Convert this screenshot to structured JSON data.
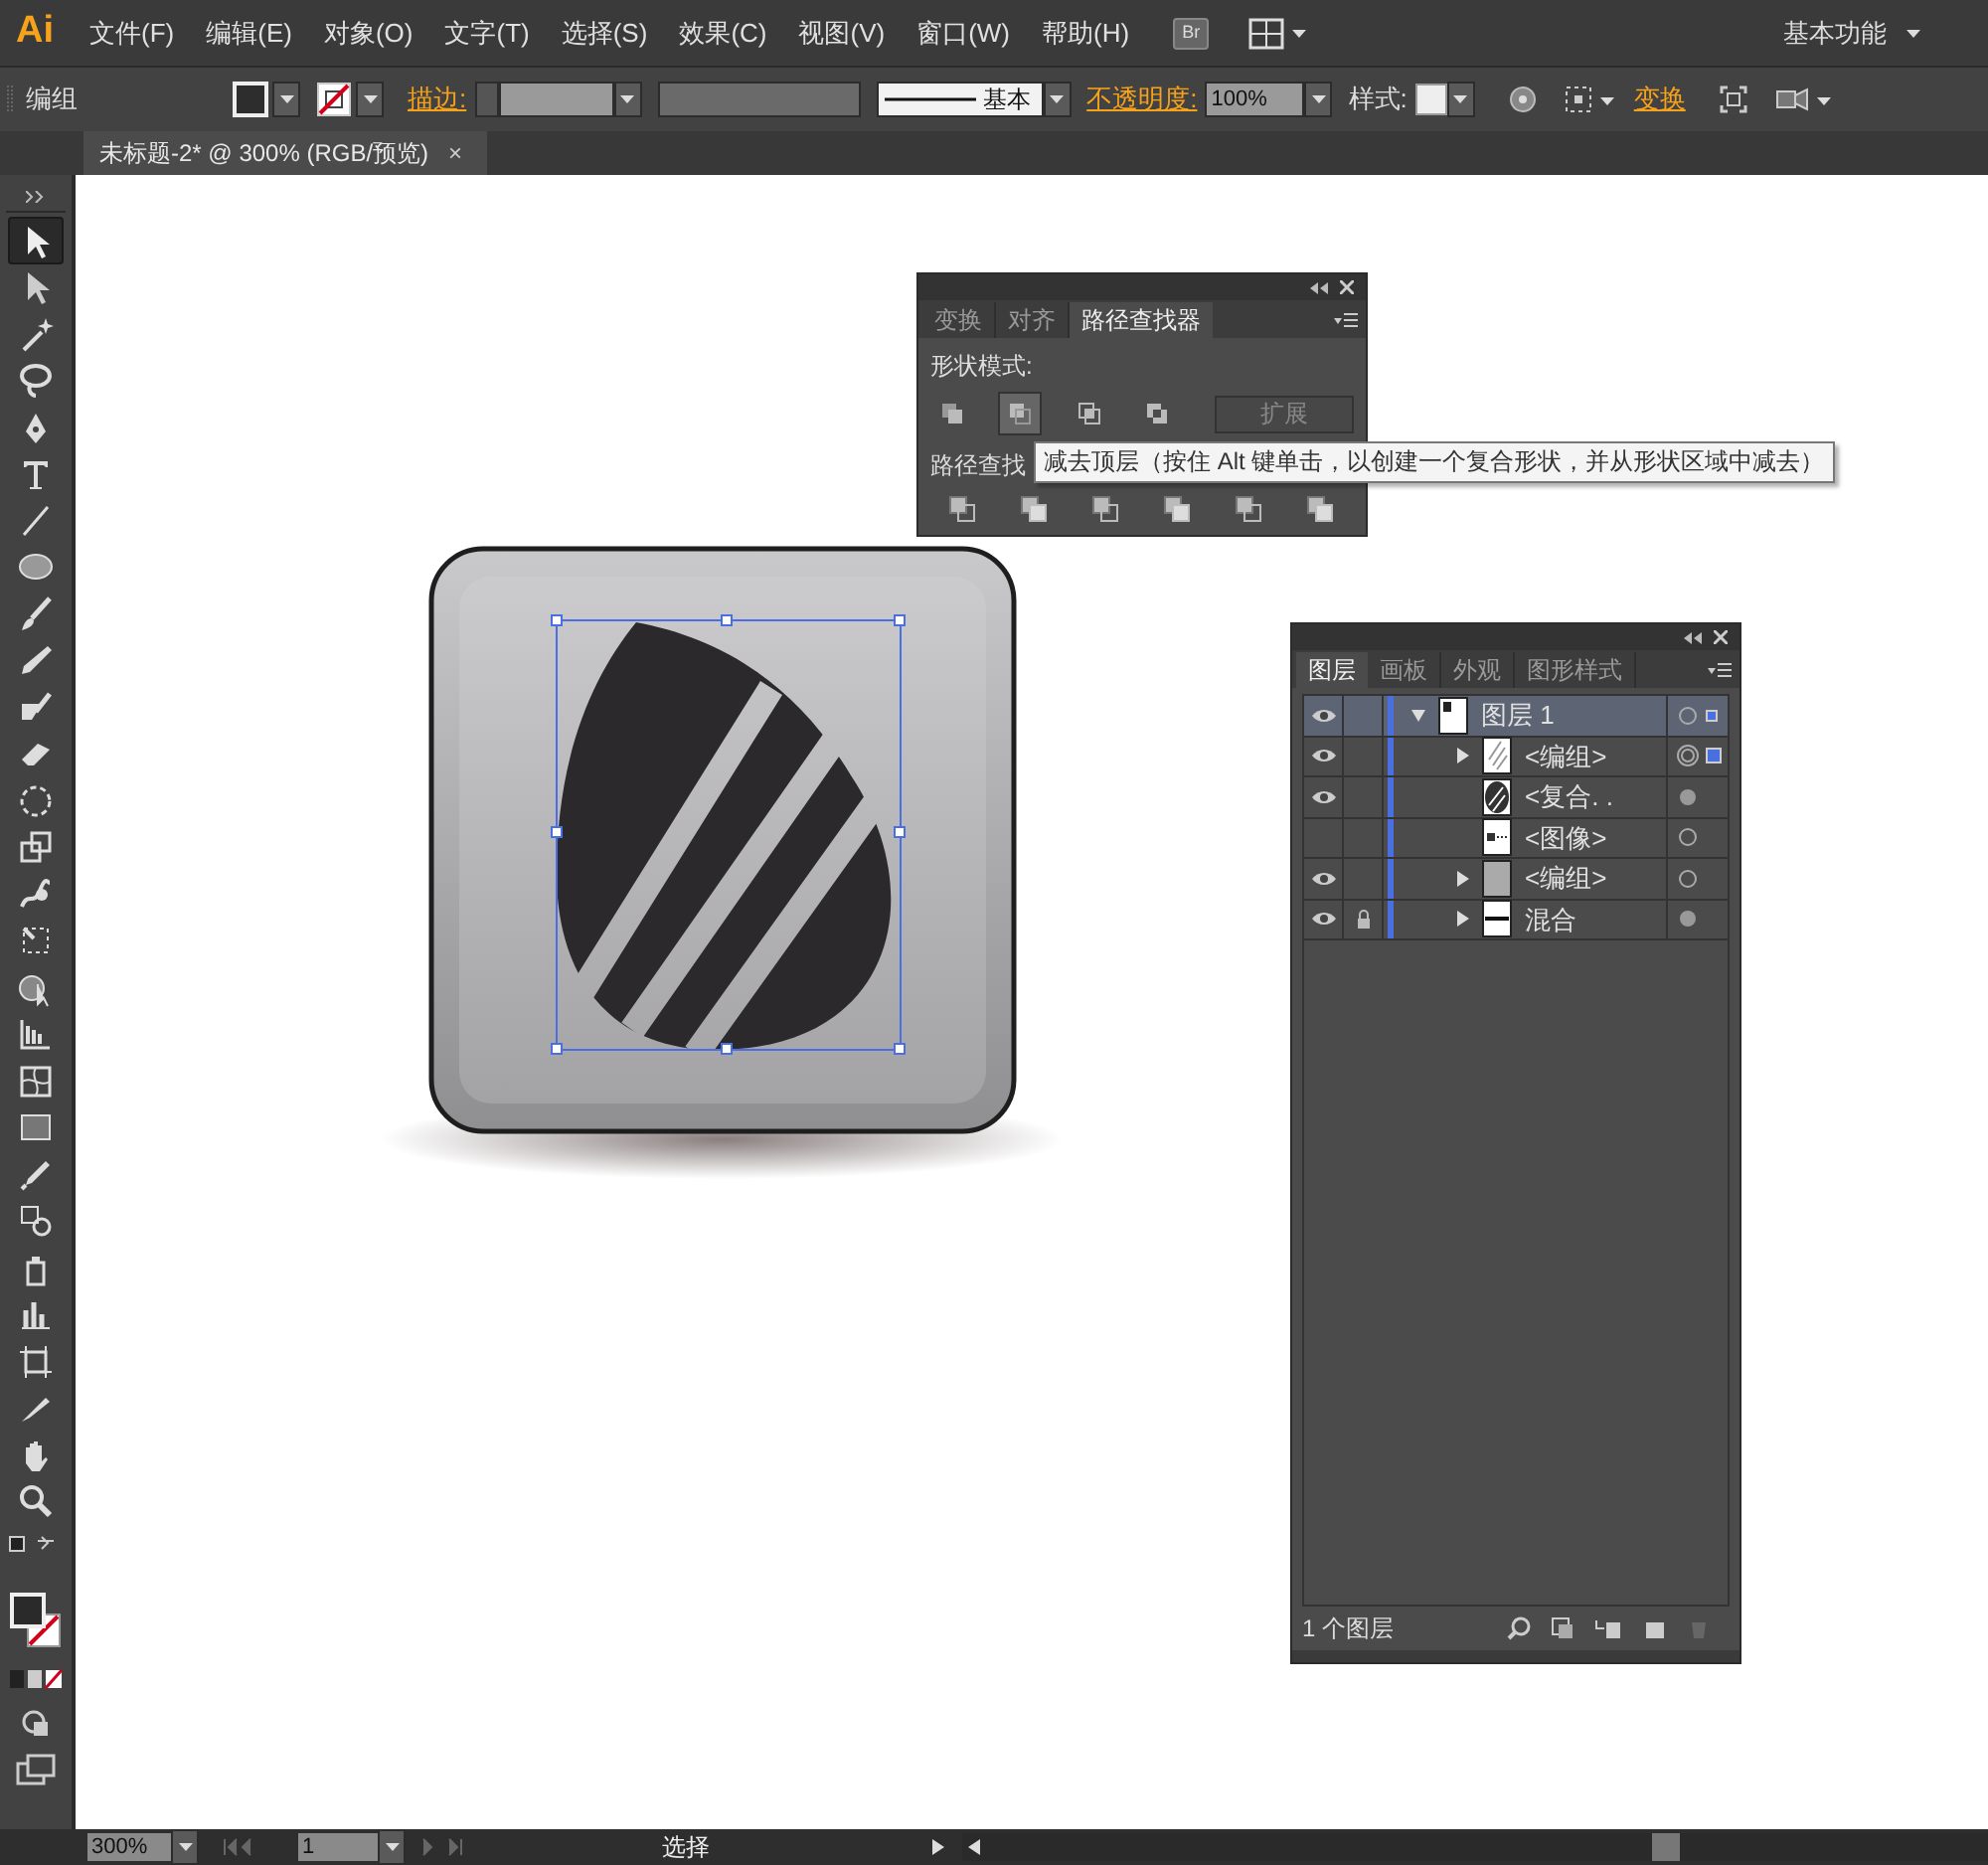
{
  "app": {
    "logo": "Ai",
    "menus": [
      "文件(F)",
      "编辑(E)",
      "对象(O)",
      "文字(T)",
      "选择(S)",
      "效果(C)",
      "视图(V)",
      "窗口(W)",
      "帮助(H)"
    ],
    "bridge": "Br",
    "workspace": "基本功能"
  },
  "control_bar": {
    "selection": "编组",
    "stroke_label": "描边:",
    "stroke_style": "基本",
    "opacity_label": "不透明度:",
    "opacity": "100%",
    "style_label": "样式:",
    "transform_link": "变换"
  },
  "document_tab": {
    "title": "未标题-2* @ 300% (RGB/预览)",
    "close": "×"
  },
  "tools": [
    {
      "kind": "select",
      "selected": true
    },
    {
      "kind": "direct",
      "selected": false
    },
    {
      "kind": "wand",
      "selected": false
    },
    {
      "kind": "lasso",
      "selected": false
    },
    {
      "kind": "pen",
      "selected": false
    },
    {
      "kind": "type",
      "selected": false
    },
    {
      "kind": "line",
      "selected": false
    },
    {
      "kind": "ellipse",
      "selected": false
    },
    {
      "kind": "brush",
      "selected": false
    },
    {
      "kind": "pencil",
      "selected": false
    },
    {
      "kind": "blob",
      "selected": false
    },
    {
      "kind": "eraser",
      "selected": false
    },
    {
      "kind": "rotate",
      "selected": false
    },
    {
      "kind": "scale",
      "selected": false
    },
    {
      "kind": "warp",
      "selected": false
    },
    {
      "kind": "transform",
      "selected": false
    },
    {
      "kind": "builder",
      "selected": false
    },
    {
      "kind": "grid",
      "selected": false
    },
    {
      "kind": "mesh",
      "selected": false
    },
    {
      "kind": "gradient",
      "selected": false
    },
    {
      "kind": "eyedropper",
      "selected": false
    },
    {
      "kind": "blend",
      "selected": false
    },
    {
      "kind": "spray",
      "selected": false
    },
    {
      "kind": "graph",
      "selected": false
    },
    {
      "kind": "artboard",
      "selected": false
    },
    {
      "kind": "slice",
      "selected": false
    },
    {
      "kind": "hand",
      "selected": false
    },
    {
      "kind": "zoom",
      "selected": false
    }
  ],
  "pathfinder_panel": {
    "tabs": [
      {
        "label": "变换",
        "selected": false
      },
      {
        "label": "对齐",
        "selected": false
      },
      {
        "label": "路径查找器",
        "selected": true
      }
    ],
    "shape_modes_label": "形状模式:",
    "shape_modes": [
      {
        "selected": false
      },
      {
        "selected": true
      },
      {
        "selected": false
      },
      {
        "selected": false
      }
    ],
    "expand_button": "扩展",
    "pathfinders_label": "路径查找"
  },
  "tooltip": "减去顶层（按住 Alt 键单击，以创建一个复合形状，并从形状区域中减去）",
  "layers_panel": {
    "tabs": [
      {
        "label": "图层",
        "selected": true
      },
      {
        "label": "画板",
        "selected": false
      },
      {
        "label": "外观",
        "selected": false
      },
      {
        "label": "图形样式",
        "selected": false
      }
    ],
    "layers": [
      {
        "name": "图层 1",
        "kind": "layer",
        "visible": true,
        "locked": false,
        "selected": true,
        "expanded": true,
        "targeted": false,
        "appearance": false,
        "has_selection": true,
        "children": [
          {
            "name": "<编组>",
            "kind": "stripes",
            "visible": true,
            "locked": false,
            "selected": false,
            "expanded": false,
            "targeted": true,
            "appearance": false,
            "has_selection": true
          },
          {
            "name": "<复合. .",
            "kind": "compound",
            "visible": true,
            "locked": false,
            "selected": false,
            "targeted": false,
            "appearance": true,
            "has_selection": false
          },
          {
            "name": "<图像>",
            "kind": "image",
            "visible": false,
            "locked": false,
            "selected": false,
            "targeted": false,
            "appearance": false,
            "has_selection": false
          },
          {
            "name": "<编组>",
            "kind": "gradient",
            "visible": true,
            "locked": false,
            "selected": false,
            "expanded": false,
            "targeted": false,
            "appearance": false,
            "has_selection": false
          },
          {
            "name": "混合",
            "kind": "blend",
            "visible": true,
            "locked": true,
            "selected": false,
            "expanded": false,
            "targeted": false,
            "appearance": true,
            "has_selection": false
          }
        ]
      }
    ],
    "footer": "1 个图层"
  },
  "status_bar": {
    "zoom": "300%",
    "artboard": "1",
    "status": "选择"
  }
}
